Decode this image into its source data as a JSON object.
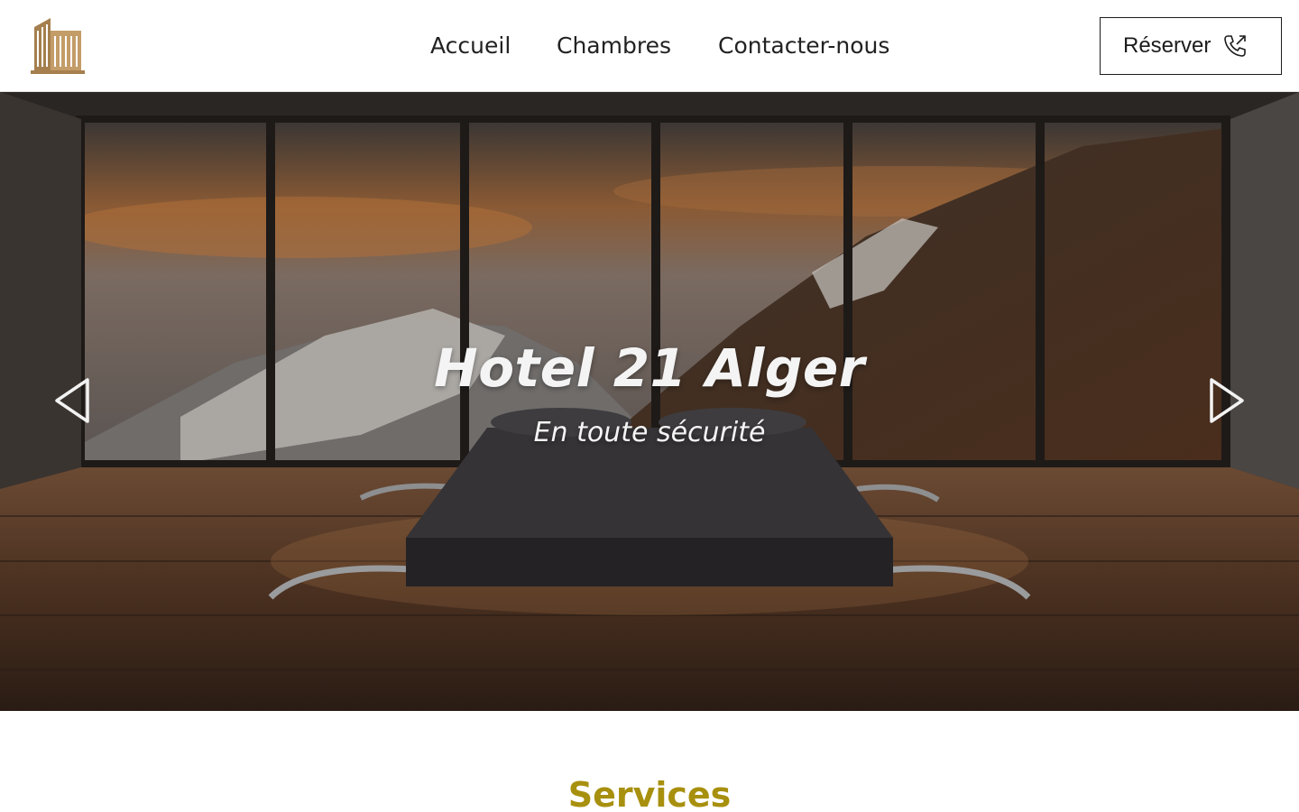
{
  "header": {
    "logo_icon": "hotel-building-icon",
    "nav": [
      {
        "label": "Accueil"
      },
      {
        "label": "Chambres"
      },
      {
        "label": "Contacter-nous"
      }
    ],
    "reserve": {
      "label": "Réserver",
      "icon": "phone-outgoing-icon"
    }
  },
  "hero": {
    "title": "Hotel 21 Alger",
    "subtitle": "En toute sécurité",
    "prev_icon": "chevron-left-icon",
    "next_icon": "chevron-right-icon"
  },
  "services": {
    "title": "Services"
  },
  "colors": {
    "accent": "#a8900f",
    "logo": "#a57f4e",
    "text": "#222222"
  }
}
